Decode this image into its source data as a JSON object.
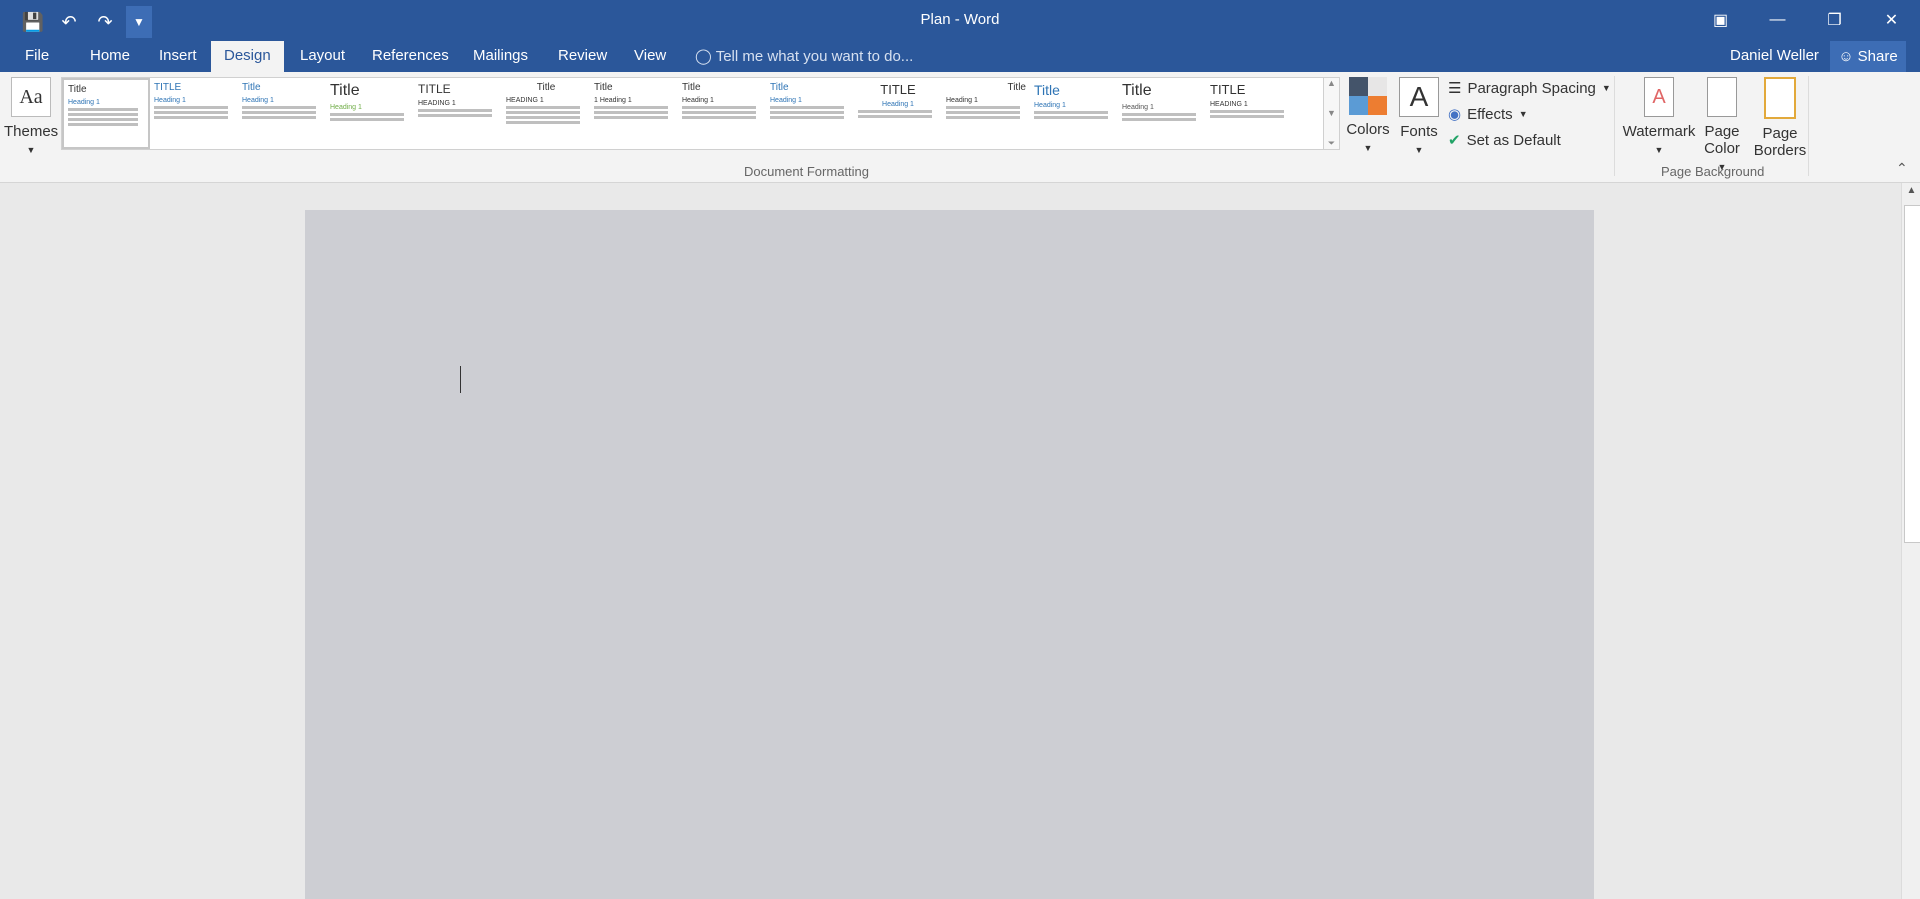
{
  "window": {
    "title": "Plan - Word"
  },
  "tabs": [
    "File",
    "Home",
    "Insert",
    "Design",
    "Layout",
    "References",
    "Mailings",
    "Review",
    "View"
  ],
  "tell_me": "Tell me what you want to do...",
  "user": "Daniel Weller",
  "share": "Share",
  "ribbon": {
    "themes": "Themes",
    "gallery": [
      {
        "title": "Title",
        "heading": "Heading 1"
      },
      {
        "title": "TITLE",
        "heading": "Heading 1"
      },
      {
        "title": "Title",
        "heading": "Heading 1"
      },
      {
        "title": "Title",
        "heading": "Heading 1"
      },
      {
        "title": "TITLE",
        "heading": "HEADING 1"
      },
      {
        "title": "Title",
        "heading": "HEADING 1"
      },
      {
        "title": "Title",
        "heading": "1 Heading 1"
      },
      {
        "title": "Title",
        "heading": "Heading 1"
      },
      {
        "title": "Title",
        "heading": "Heading 1"
      },
      {
        "title": "TITLE",
        "heading": "Heading 1"
      },
      {
        "title": "Title",
        "heading": "Heading 1"
      },
      {
        "title": "Title",
        "heading": "Heading 1"
      },
      {
        "title": "Title",
        "heading": "Heading 1"
      },
      {
        "title": "TITLE",
        "heading": "HEADING 1"
      }
    ],
    "colors": "Colors",
    "fonts": "Fonts",
    "paragraph_spacing": "Paragraph Spacing",
    "effects": "Effects",
    "set_as_default": "Set as Default",
    "document_formatting": "Document Formatting",
    "watermark": "Watermark",
    "page_color_1": "Page",
    "page_color_2": "Color",
    "page_borders_1": "Page",
    "page_borders_2": "Borders",
    "page_background": "Page Background"
  },
  "accent": "#2b579a"
}
